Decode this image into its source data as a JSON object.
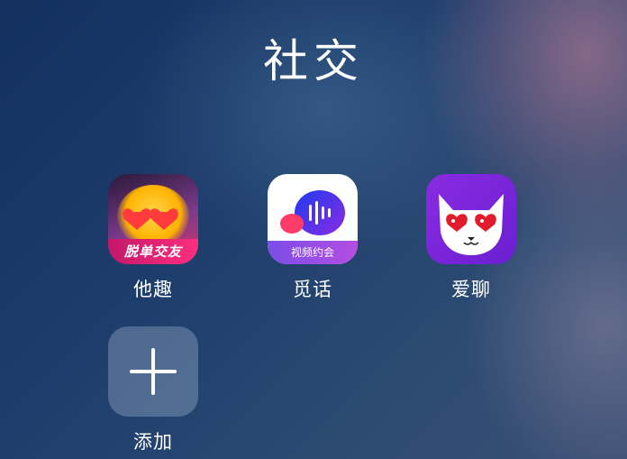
{
  "folder": {
    "title": "社交"
  },
  "apps": [
    {
      "label": "他趣",
      "icon": "taqu-app-icon",
      "badge_text": "脱单交友"
    },
    {
      "label": "觅话",
      "icon": "mihua-app-icon",
      "badge_text": "视频约会"
    },
    {
      "label": "爱聊",
      "icon": "ailiao-app-icon"
    }
  ],
  "add": {
    "label": "添加",
    "icon": "plus-icon"
  },
  "colors": {
    "label_text": "#ffffff",
    "taqu_banner": "#ff2e7e",
    "mihua_accent": "#7b4de8",
    "ailiao_bg": "#8a2be2"
  }
}
